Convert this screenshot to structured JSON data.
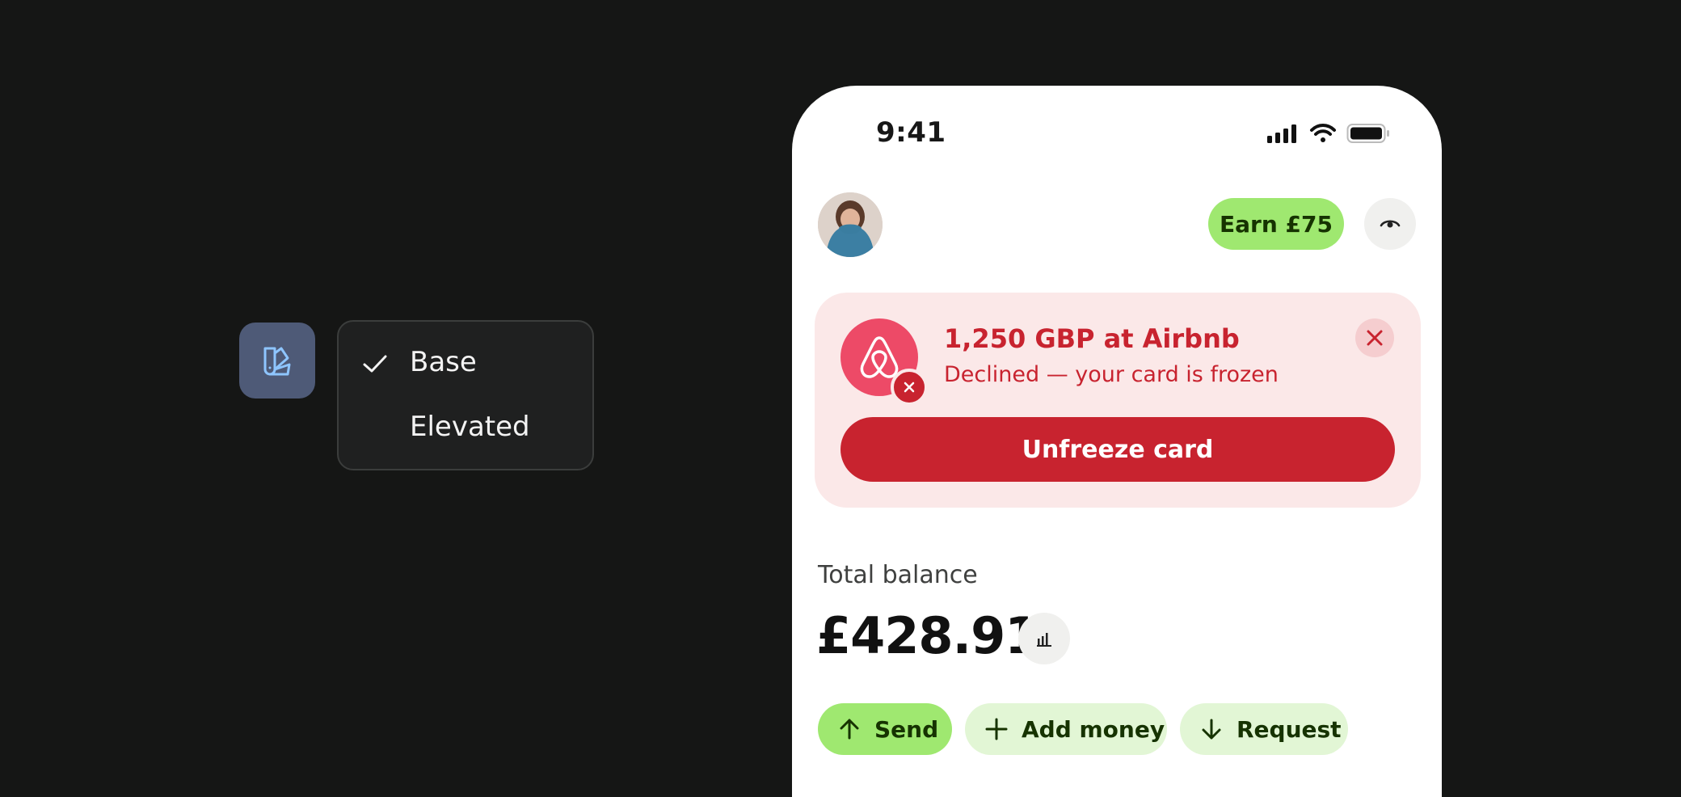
{
  "theme_selector": {
    "options": [
      {
        "label": "Base",
        "selected": true
      },
      {
        "label": "Elevated",
        "selected": false
      }
    ]
  },
  "status_bar": {
    "time": "9:41"
  },
  "header": {
    "earn_label": "Earn £75"
  },
  "alert": {
    "title": "1,250 GBP at Airbnb",
    "subtitle": "Declined — your card is frozen",
    "action_label": "Unfreeze card"
  },
  "balance": {
    "label": "Total balance",
    "value": "£428.91"
  },
  "actions": {
    "send": "Send",
    "add_money": "Add money",
    "request": "Request"
  },
  "colors": {
    "page_background": "#151615",
    "accent_green": "#9fe870",
    "light_green": "#e2f6d5",
    "danger_red": "#c8232f",
    "alert_background": "#fbe8e8"
  }
}
